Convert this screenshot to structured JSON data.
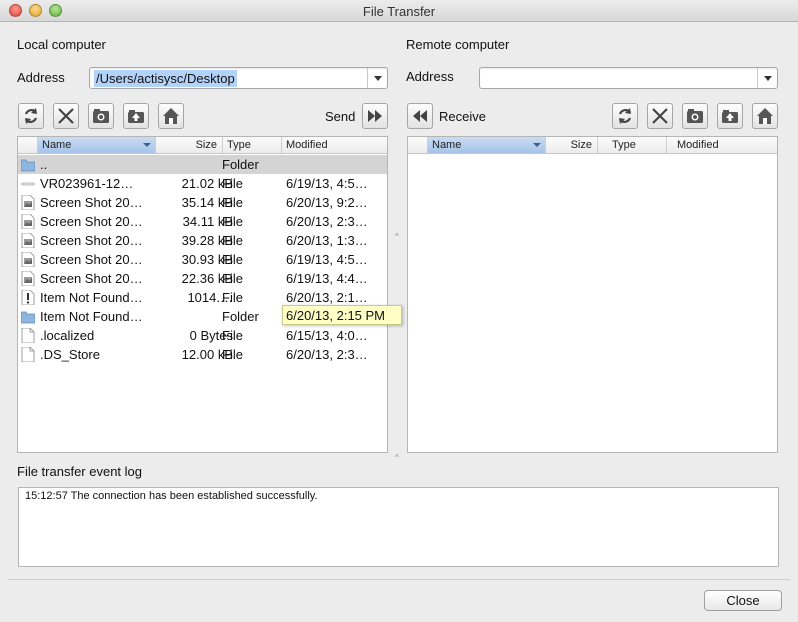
{
  "window": {
    "title": "File Transfer"
  },
  "local": {
    "heading": "Local computer",
    "address_label": "Address",
    "address_value": "/Users/actisysc/Desktop",
    "send_label": "Send",
    "columns": {
      "name": "Name",
      "size": "Size",
      "type": "Type",
      "modified": "Modified"
    },
    "files": [
      {
        "name": "..",
        "size": "",
        "type": "Folder",
        "modified": "",
        "icon": "folder-icon"
      },
      {
        "name": "VR023961-12…",
        "size": "21.02 kB",
        "type": "File",
        "modified": "6/19/13, 4:5…",
        "icon": "blank-file-icon"
      },
      {
        "name": "Screen Shot 20…",
        "size": "35.14 kB",
        "type": "File",
        "modified": "6/20/13, 9:2…",
        "icon": "image-file-icon"
      },
      {
        "name": "Screen Shot 20…",
        "size": "34.11 kB",
        "type": "File",
        "modified": "6/20/13, 2:3…",
        "icon": "image-file-icon"
      },
      {
        "name": "Screen Shot 20…",
        "size": "39.28 kB",
        "type": "File",
        "modified": "6/20/13, 1:3…",
        "icon": "image-file-icon"
      },
      {
        "name": "Screen Shot 20…",
        "size": "30.93 kB",
        "type": "File",
        "modified": "6/19/13, 4:5…",
        "icon": "image-file-icon"
      },
      {
        "name": "Screen Shot 20…",
        "size": "22.36 kB",
        "type": "File",
        "modified": "6/19/13, 4:4…",
        "icon": "image-file-icon"
      },
      {
        "name": "Item Not Found…",
        "size": "1014.…",
        "type": "File",
        "modified": "6/20/13, 2:1…",
        "icon": "alias-file-icon"
      },
      {
        "name": "Item Not Found…",
        "size": "",
        "type": "Folder",
        "modified": "",
        "icon": "folder-icon"
      },
      {
        "name": ".localized",
        "size": "0 Bytes",
        "type": "File",
        "modified": "6/15/13, 4:0…",
        "icon": "document-icon"
      },
      {
        "name": ".DS_Store",
        "size": "12.00 kB",
        "type": "File",
        "modified": "6/20/13, 2:3…",
        "icon": "document-icon"
      }
    ],
    "tooltip": "6/20/13, 2:15 PM"
  },
  "remote": {
    "heading": "Remote computer",
    "address_label": "Address",
    "address_value": "",
    "receive_label": "Receive",
    "columns": {
      "name": "Name",
      "size": "Size",
      "type": "Type",
      "modified": "Modified"
    }
  },
  "log": {
    "heading": "File transfer event log",
    "entries": [
      "15:12:57 The connection has been established successfully."
    ]
  },
  "footer": {
    "close_label": "Close"
  },
  "colors": {
    "selection": "#b3d2f7",
    "sorted_header": "#a7c3e8",
    "tooltip_bg": "#ffffc6"
  }
}
